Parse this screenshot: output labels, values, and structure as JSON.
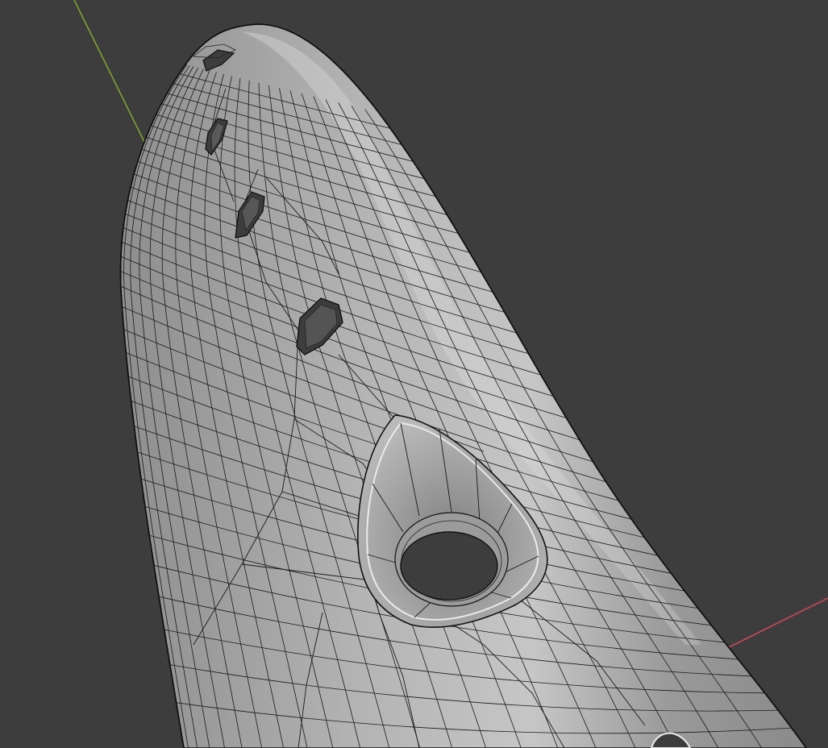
{
  "viewport": {
    "background": "#3d3d3d",
    "mesh_fill": "#a6a6a6",
    "mesh_highlight": "#c8c8c8",
    "mesh_shadow": "#8c8c8c",
    "wire_color": "#1a1a1a",
    "hole_color": "#3d3d3d",
    "y_axis_color": "#7ea332",
    "x_axis_color": "#c84b57"
  },
  "axes": [
    {
      "name": "y-axis-line",
      "color_key": "y_axis_color"
    },
    {
      "name": "x-axis-line",
      "color_key": "x_axis_color"
    }
  ],
  "object": {
    "kind": "subdivided-tube-mesh",
    "holes": 5
  }
}
